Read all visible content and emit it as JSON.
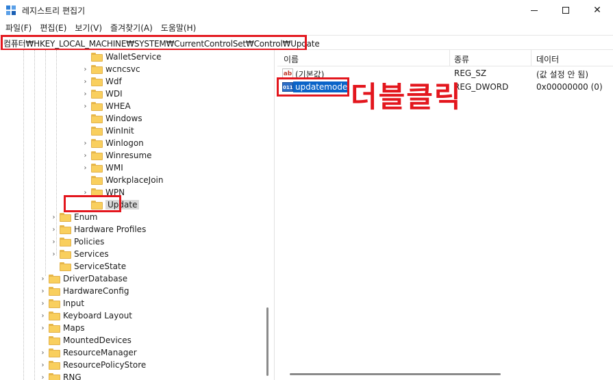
{
  "window": {
    "title": "레지스트리 편집기",
    "controls": {
      "minimize": "minimize-icon",
      "maximize": "maximize-icon",
      "close": "✕"
    }
  },
  "menu": [
    "파일(F)",
    "편집(E)",
    "보기(V)",
    "즐겨찾기(A)",
    "도움말(H)"
  ],
  "address": "컴퓨터₩HKEY_LOCAL_MACHINE₩SYSTEM₩CurrentControlSet₩Control₩Update",
  "tree": [
    {
      "label": "WalletService",
      "expandable": false
    },
    {
      "label": "wcncsvc",
      "expandable": true
    },
    {
      "label": "Wdf",
      "expandable": true
    },
    {
      "label": "WDI",
      "expandable": true
    },
    {
      "label": "WHEA",
      "expandable": true
    },
    {
      "label": "Windows",
      "expandable": false
    },
    {
      "label": "WinInit",
      "expandable": false
    },
    {
      "label": "Winlogon",
      "expandable": true
    },
    {
      "label": "Winresume",
      "expandable": true
    },
    {
      "label": "WMI",
      "expandable": true
    },
    {
      "label": "WorkplaceJoin",
      "expandable": false
    },
    {
      "label": "WPN",
      "expandable": true
    },
    {
      "label": "Update",
      "expandable": false,
      "selected": true
    },
    {
      "label": "Enum",
      "expandable": true
    },
    {
      "label": "Hardware Profiles",
      "expandable": true
    },
    {
      "label": "Policies",
      "expandable": true
    },
    {
      "label": "Services",
      "expandable": true
    },
    {
      "label": "ServiceState",
      "expandable": false
    },
    {
      "label": "DriverDatabase",
      "expandable": true
    },
    {
      "label": "HardwareConfig",
      "expandable": true
    },
    {
      "label": "Input",
      "expandable": true
    },
    {
      "label": "Keyboard Layout",
      "expandable": true
    },
    {
      "label": "Maps",
      "expandable": true
    },
    {
      "label": "MountedDevices",
      "expandable": false
    },
    {
      "label": "ResourceManager",
      "expandable": true
    },
    {
      "label": "ResourcePolicyStore",
      "expandable": true
    },
    {
      "label": "RNG",
      "expandable": true
    }
  ],
  "columns": {
    "name": "이름",
    "type": "종류",
    "data": "데이터"
  },
  "values": [
    {
      "icon": "string-value-icon",
      "icon_text": "ab",
      "name": "(기본값)",
      "type": "REG_SZ",
      "data": "(값 설정 안 됨)"
    },
    {
      "icon": "binary-value-icon",
      "icon_text": "011",
      "name": "updatemode",
      "type": "REG_DWORD",
      "data": "0x00000000 (0)",
      "selected": true
    }
  ],
  "annotation": "더블클릭",
  "colors": {
    "highlight": "#e3161d",
    "selection": "#0a64c8",
    "folder": "#f9cf5e"
  }
}
